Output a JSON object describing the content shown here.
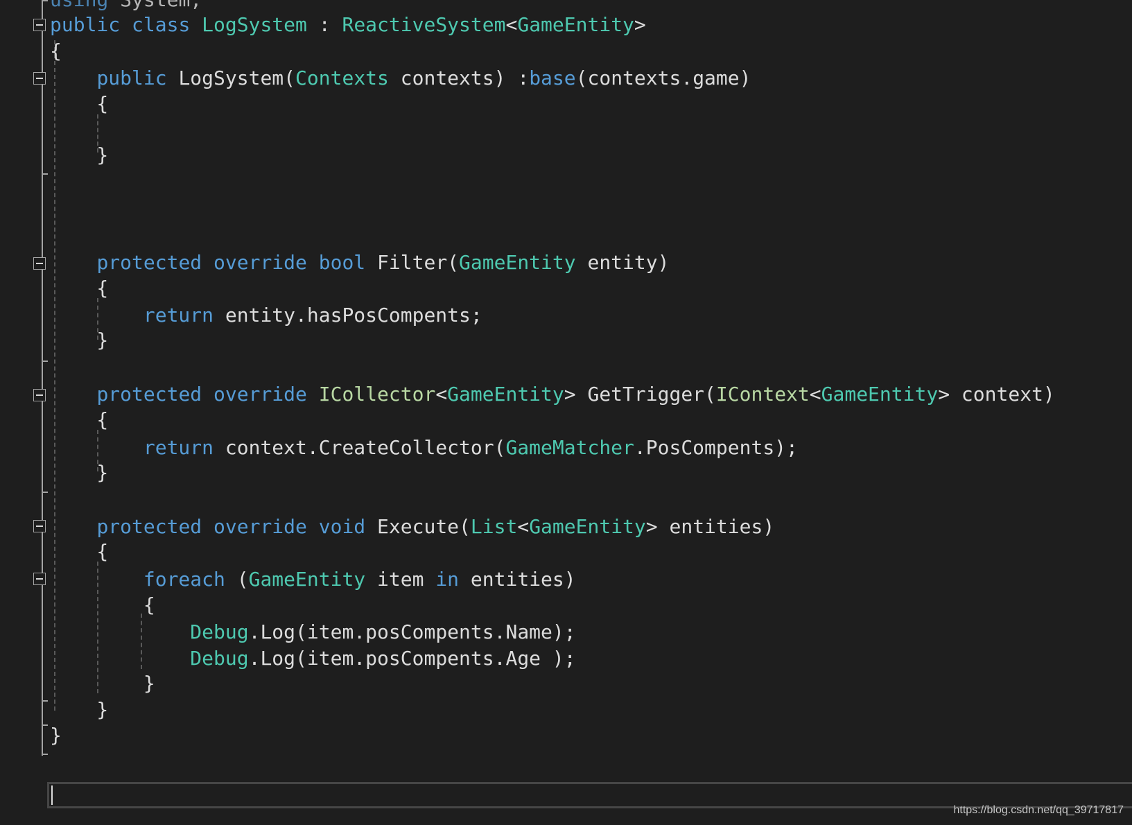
{
  "editor": {
    "language": "C#",
    "lines": [
      [
        {
          "k": "kw",
          "t": "using"
        },
        {
          "k": "tx",
          "t": " System;"
        }
      ],
      [
        {
          "k": "kw",
          "t": "public"
        },
        {
          "k": "tx",
          "t": " "
        },
        {
          "k": "kw",
          "t": "class"
        },
        {
          "k": "tx",
          "t": " "
        },
        {
          "k": "ty",
          "t": "LogSystem"
        },
        {
          "k": "tx",
          "t": " : "
        },
        {
          "k": "ty",
          "t": "ReactiveSystem"
        },
        {
          "k": "tx",
          "t": "<"
        },
        {
          "k": "ty",
          "t": "GameEntity"
        },
        {
          "k": "tx",
          "t": ">"
        }
      ],
      [
        {
          "k": "tx",
          "t": "{"
        }
      ],
      [
        {
          "k": "tx",
          "t": "    "
        },
        {
          "k": "kw",
          "t": "public"
        },
        {
          "k": "tx",
          "t": " LogSystem("
        },
        {
          "k": "ty",
          "t": "Contexts"
        },
        {
          "k": "tx",
          "t": " contexts) :"
        },
        {
          "k": "kw",
          "t": "base"
        },
        {
          "k": "tx",
          "t": "(contexts.game)"
        }
      ],
      [
        {
          "k": "tx",
          "t": "    {"
        }
      ],
      [],
      [
        {
          "k": "tx",
          "t": "    }"
        }
      ],
      [],
      [],
      [],
      [
        {
          "k": "tx",
          "t": "    "
        },
        {
          "k": "kw",
          "t": "protected"
        },
        {
          "k": "tx",
          "t": " "
        },
        {
          "k": "kw",
          "t": "override"
        },
        {
          "k": "tx",
          "t": " "
        },
        {
          "k": "kw",
          "t": "bool"
        },
        {
          "k": "tx",
          "t": " Filter("
        },
        {
          "k": "ty",
          "t": "GameEntity"
        },
        {
          "k": "tx",
          "t": " entity)"
        }
      ],
      [
        {
          "k": "tx",
          "t": "    {"
        }
      ],
      [
        {
          "k": "tx",
          "t": "        "
        },
        {
          "k": "kw",
          "t": "return"
        },
        {
          "k": "tx",
          "t": " entity.hasPosCompents;"
        }
      ],
      [
        {
          "k": "tx",
          "t": "    }"
        }
      ],
      [],
      [
        {
          "k": "tx",
          "t": "    "
        },
        {
          "k": "kw",
          "t": "protected"
        },
        {
          "k": "tx",
          "t": " "
        },
        {
          "k": "kw",
          "t": "override"
        },
        {
          "k": "tx",
          "t": " "
        },
        {
          "k": "if",
          "t": "ICollector"
        },
        {
          "k": "tx",
          "t": "<"
        },
        {
          "k": "ty",
          "t": "GameEntity"
        },
        {
          "k": "tx",
          "t": "> GetTrigger("
        },
        {
          "k": "if",
          "t": "IContext"
        },
        {
          "k": "tx",
          "t": "<"
        },
        {
          "k": "ty",
          "t": "GameEntity"
        },
        {
          "k": "tx",
          "t": "> context)"
        }
      ],
      [
        {
          "k": "tx",
          "t": "    {"
        }
      ],
      [
        {
          "k": "tx",
          "t": "        "
        },
        {
          "k": "kw",
          "t": "return"
        },
        {
          "k": "tx",
          "t": " context.CreateCollector("
        },
        {
          "k": "ty",
          "t": "GameMatcher"
        },
        {
          "k": "tx",
          "t": ".PosCompents);"
        }
      ],
      [
        {
          "k": "tx",
          "t": "    }"
        }
      ],
      [],
      [
        {
          "k": "tx",
          "t": "    "
        },
        {
          "k": "kw",
          "t": "protected"
        },
        {
          "k": "tx",
          "t": " "
        },
        {
          "k": "kw",
          "t": "override"
        },
        {
          "k": "tx",
          "t": " "
        },
        {
          "k": "kw",
          "t": "void"
        },
        {
          "k": "tx",
          "t": " Execute("
        },
        {
          "k": "ty",
          "t": "List"
        },
        {
          "k": "tx",
          "t": "<"
        },
        {
          "k": "ty",
          "t": "GameEntity"
        },
        {
          "k": "tx",
          "t": "> entities)"
        }
      ],
      [
        {
          "k": "tx",
          "t": "    {"
        }
      ],
      [
        {
          "k": "tx",
          "t": "        "
        },
        {
          "k": "kw",
          "t": "foreach"
        },
        {
          "k": "tx",
          "t": " ("
        },
        {
          "k": "ty",
          "t": "GameEntity"
        },
        {
          "k": "tx",
          "t": " item "
        },
        {
          "k": "kw",
          "t": "in"
        },
        {
          "k": "tx",
          "t": " entities)"
        }
      ],
      [
        {
          "k": "tx",
          "t": "        {"
        }
      ],
      [
        {
          "k": "tx",
          "t": "            "
        },
        {
          "k": "ty",
          "t": "Debug"
        },
        {
          "k": "tx",
          "t": ".Log(item.posCompents.Name);"
        }
      ],
      [
        {
          "k": "tx",
          "t": "            "
        },
        {
          "k": "ty",
          "t": "Debug"
        },
        {
          "k": "tx",
          "t": ".Log(item.posCompents.Age );"
        }
      ],
      [
        {
          "k": "tx",
          "t": "        }"
        }
      ],
      [
        {
          "k": "tx",
          "t": "    }"
        }
      ],
      [
        {
          "k": "tx",
          "t": "}"
        }
      ]
    ]
  },
  "watermark": "https://blog.csdn.net/qq_39717817"
}
